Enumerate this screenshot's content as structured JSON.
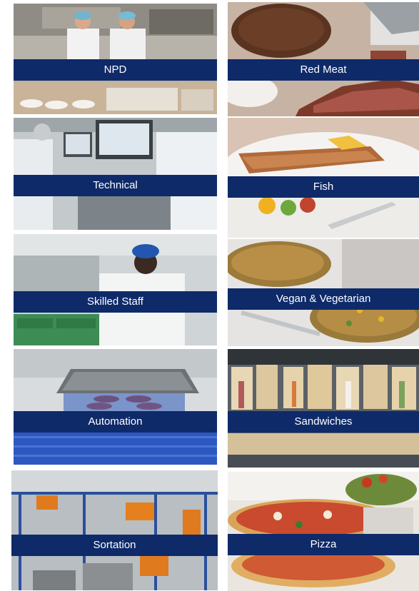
{
  "tiles": {
    "npd": {
      "label": "NPD"
    },
    "technical": {
      "label": "Technical"
    },
    "skilled_staff": {
      "label": "Skilled Staff"
    },
    "automation": {
      "label": "Automation"
    },
    "sortation": {
      "label": "Sortation"
    },
    "red_meat": {
      "label": "Red Meat"
    },
    "fish": {
      "label": "Fish"
    },
    "vegan_vegetarian": {
      "label": "Vegan & Vegetarian"
    },
    "sandwiches": {
      "label": "Sandwiches"
    },
    "pizza": {
      "label": "Pizza"
    }
  },
  "colors": {
    "label_band": "#0e2a69",
    "label_text": "#ffffff"
  }
}
